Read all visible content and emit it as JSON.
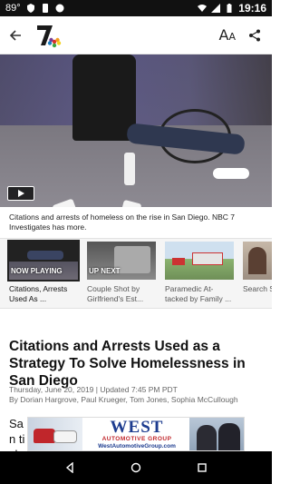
{
  "status_bar": {
    "time": "19:16",
    "notification_icons": [
      "temperature-icon",
      "shield-icon",
      "sim-icon",
      "circle-icon"
    ],
    "temperature": "89°"
  },
  "app_bar": {
    "logo_text": "7",
    "font_size_label": "A",
    "font_size_small": "A"
  },
  "video": {
    "caption": "Citations and arrests of homeless on the rise in San Diego. NBC 7 Investigates has more."
  },
  "playlist": [
    {
      "badge": "NOW PLAYING",
      "title": "Citations, Arrests Used As ...",
      "active": true
    },
    {
      "badge": "UP NEXT",
      "title": "Couple Shot by Girlfriend's Est...",
      "active": false
    },
    {
      "badge": "",
      "title": "Paramedic At-tacked by Family ...",
      "active": false
    },
    {
      "badge": "",
      "title": "Search S Man Acc",
      "active": false
    }
  ],
  "article": {
    "title": "Citations and Arrests Used as a Strategy To Solve Homelessness in San Diego",
    "date": "Thursday, June 20, 2019 | Updated 7:45 PM PDT",
    "byline": "By Dorian Hargrove, Paul Krueger, Tom Jones, Sophia McCullough",
    "body_visible": "San tick"
  },
  "ad": {
    "brand": "WEST",
    "sub": "AUTOMOTIVE GROUP",
    "url": "WestAutomotiveGroup.com"
  },
  "colors": {
    "status_bar": "#111111",
    "nav_bar": "#000000",
    "ad_blue": "#1d3c8f",
    "ad_red": "#c0262b"
  }
}
